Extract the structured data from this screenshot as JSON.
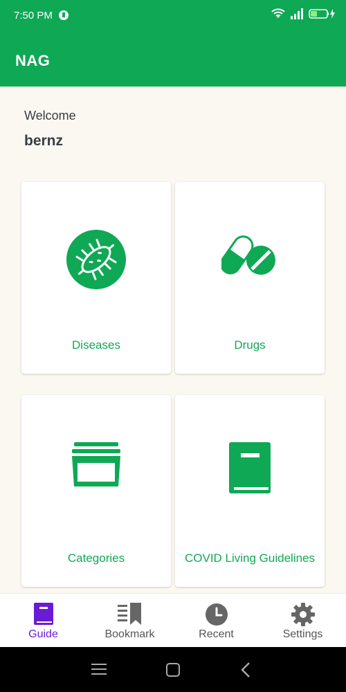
{
  "status_bar": {
    "time": "7:50 PM",
    "icons": [
      "app-notification-icon",
      "wifi-icon",
      "signal-icon",
      "battery-charging-icon"
    ]
  },
  "app_bar": {
    "title": "NAG"
  },
  "welcome": {
    "greeting": "Welcome",
    "username": "bernz"
  },
  "cards": [
    {
      "label": "Diseases",
      "icon": "bacteria-icon"
    },
    {
      "label": "Drugs",
      "icon": "pills-icon"
    },
    {
      "label": "Categories",
      "icon": "folders-icon"
    },
    {
      "label": "COVID Living Guidelines",
      "icon": "book-icon"
    }
  ],
  "bottom_nav": [
    {
      "label": "Guide",
      "icon": "book-icon",
      "active": true
    },
    {
      "label": "Bookmark",
      "icon": "bookmark-icon",
      "active": false
    },
    {
      "label": "Recent",
      "icon": "clock-icon",
      "active": false
    },
    {
      "label": "Settings",
      "icon": "gear-icon",
      "active": false
    }
  ],
  "system_nav": [
    "menu-icon",
    "home-icon",
    "back-icon"
  ],
  "colors": {
    "primary": "#0fa855",
    "active_nav": "#6a1bd6",
    "background": "#faf8f0",
    "text": "#3a3d45"
  }
}
